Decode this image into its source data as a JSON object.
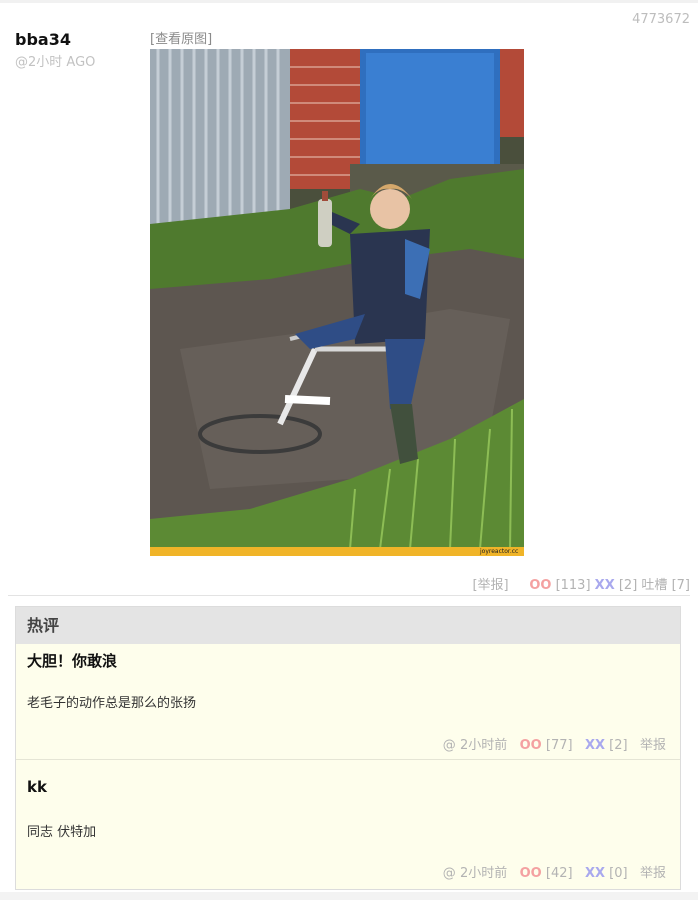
{
  "post": {
    "id": "4773672",
    "author": "bba34",
    "time": "@2小时 AGO",
    "view_original": "[查看原图]",
    "photo_watermark": "joyreactor.cc",
    "report": "[举报]",
    "oo_label": "OO",
    "oo_count": "[113]",
    "xx_label": "XX",
    "xx_count": "[2]",
    "tucao_label": "吐槽",
    "tucao_count": "[7]"
  },
  "hot_comments": {
    "title": "热评",
    "items": [
      {
        "name": "大胆！你敢浪",
        "text": "老毛子的动作总是那么的张扬",
        "at": "@",
        "time": "2小时前",
        "oo_label": "OO",
        "oo_count": "[77]",
        "xx_label": "XX",
        "xx_count": "[2]",
        "report": "举报"
      },
      {
        "name": "kk",
        "text": "同志 伏特加",
        "at": "@",
        "time": "2小时前",
        "oo_label": "OO",
        "oo_count": "[42]",
        "xx_label": "XX",
        "xx_count": "[0]",
        "report": "举报"
      }
    ]
  }
}
